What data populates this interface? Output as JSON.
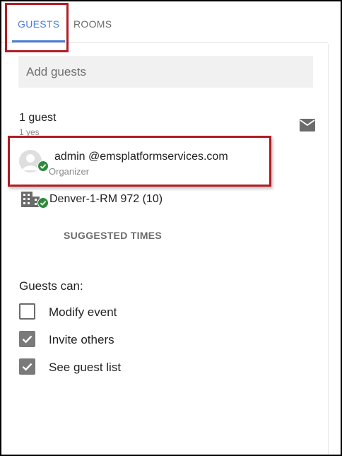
{
  "tabs": {
    "guests_label": "GUESTS",
    "rooms_label": "ROOMS"
  },
  "add_guests": {
    "placeholder": "Add guests"
  },
  "guest_list": {
    "count_label": "1 guest",
    "summary": "1 yes",
    "guests": [
      {
        "email": "admin @emsplatformservices.com",
        "role": "Organizer",
        "status": "accepted"
      }
    ],
    "rooms": [
      {
        "name": "Denver-1-RM 972 (10)",
        "status": "accepted"
      }
    ]
  },
  "suggested_times_label": "SUGGESTED TIMES",
  "permissions": {
    "heading": "Guests can:",
    "items": [
      {
        "label": "Modify event",
        "checked": false
      },
      {
        "label": "Invite others",
        "checked": true
      },
      {
        "label": "See guest list",
        "checked": true
      }
    ]
  },
  "icons": {
    "mail": "mail-icon",
    "avatar": "person-avatar-icon",
    "room": "building-icon",
    "accepted": "check-circle-icon"
  },
  "colors": {
    "accent": "#4d7fd6",
    "accepted_green": "#2e8b3d",
    "callout_red": "#b01d24",
    "checkbox_gray": "#7a7a7a"
  }
}
